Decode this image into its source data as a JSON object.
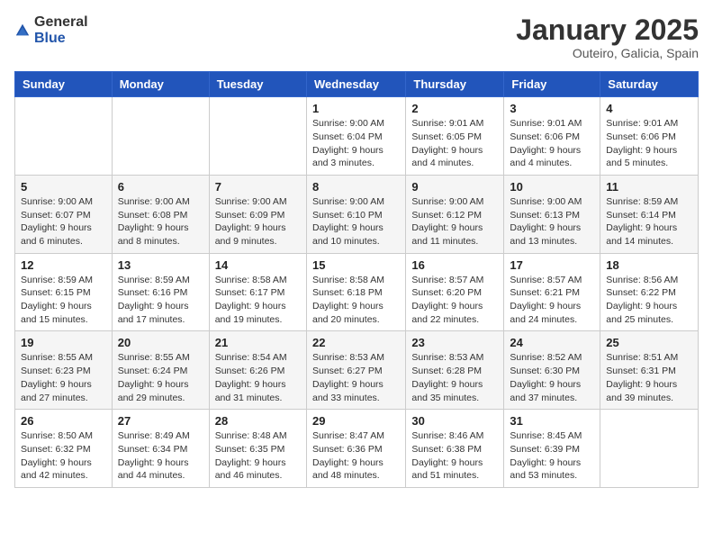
{
  "logo": {
    "general": "General",
    "blue": "Blue"
  },
  "header": {
    "month": "January 2025",
    "location": "Outeiro, Galicia, Spain"
  },
  "weekdays": [
    "Sunday",
    "Monday",
    "Tuesday",
    "Wednesday",
    "Thursday",
    "Friday",
    "Saturday"
  ],
  "weeks": [
    [
      {
        "day": "",
        "sunrise": "",
        "sunset": "",
        "daylight": ""
      },
      {
        "day": "",
        "sunrise": "",
        "sunset": "",
        "daylight": ""
      },
      {
        "day": "",
        "sunrise": "",
        "sunset": "",
        "daylight": ""
      },
      {
        "day": "1",
        "sunrise": "9:00 AM",
        "sunset": "6:04 PM",
        "daylight": "9 hours and 3 minutes."
      },
      {
        "day": "2",
        "sunrise": "9:01 AM",
        "sunset": "6:05 PM",
        "daylight": "9 hours and 4 minutes."
      },
      {
        "day": "3",
        "sunrise": "9:01 AM",
        "sunset": "6:06 PM",
        "daylight": "9 hours and 4 minutes."
      },
      {
        "day": "4",
        "sunrise": "9:01 AM",
        "sunset": "6:06 PM",
        "daylight": "9 hours and 5 minutes."
      }
    ],
    [
      {
        "day": "5",
        "sunrise": "9:00 AM",
        "sunset": "6:07 PM",
        "daylight": "9 hours and 6 minutes."
      },
      {
        "day": "6",
        "sunrise": "9:00 AM",
        "sunset": "6:08 PM",
        "daylight": "9 hours and 8 minutes."
      },
      {
        "day": "7",
        "sunrise": "9:00 AM",
        "sunset": "6:09 PM",
        "daylight": "9 hours and 9 minutes."
      },
      {
        "day": "8",
        "sunrise": "9:00 AM",
        "sunset": "6:10 PM",
        "daylight": "9 hours and 10 minutes."
      },
      {
        "day": "9",
        "sunrise": "9:00 AM",
        "sunset": "6:12 PM",
        "daylight": "9 hours and 11 minutes."
      },
      {
        "day": "10",
        "sunrise": "9:00 AM",
        "sunset": "6:13 PM",
        "daylight": "9 hours and 13 minutes."
      },
      {
        "day": "11",
        "sunrise": "8:59 AM",
        "sunset": "6:14 PM",
        "daylight": "9 hours and 14 minutes."
      }
    ],
    [
      {
        "day": "12",
        "sunrise": "8:59 AM",
        "sunset": "6:15 PM",
        "daylight": "9 hours and 15 minutes."
      },
      {
        "day": "13",
        "sunrise": "8:59 AM",
        "sunset": "6:16 PM",
        "daylight": "9 hours and 17 minutes."
      },
      {
        "day": "14",
        "sunrise": "8:58 AM",
        "sunset": "6:17 PM",
        "daylight": "9 hours and 19 minutes."
      },
      {
        "day": "15",
        "sunrise": "8:58 AM",
        "sunset": "6:18 PM",
        "daylight": "9 hours and 20 minutes."
      },
      {
        "day": "16",
        "sunrise": "8:57 AM",
        "sunset": "6:20 PM",
        "daylight": "9 hours and 22 minutes."
      },
      {
        "day": "17",
        "sunrise": "8:57 AM",
        "sunset": "6:21 PM",
        "daylight": "9 hours and 24 minutes."
      },
      {
        "day": "18",
        "sunrise": "8:56 AM",
        "sunset": "6:22 PM",
        "daylight": "9 hours and 25 minutes."
      }
    ],
    [
      {
        "day": "19",
        "sunrise": "8:55 AM",
        "sunset": "6:23 PM",
        "daylight": "9 hours and 27 minutes."
      },
      {
        "day": "20",
        "sunrise": "8:55 AM",
        "sunset": "6:24 PM",
        "daylight": "9 hours and 29 minutes."
      },
      {
        "day": "21",
        "sunrise": "8:54 AM",
        "sunset": "6:26 PM",
        "daylight": "9 hours and 31 minutes."
      },
      {
        "day": "22",
        "sunrise": "8:53 AM",
        "sunset": "6:27 PM",
        "daylight": "9 hours and 33 minutes."
      },
      {
        "day": "23",
        "sunrise": "8:53 AM",
        "sunset": "6:28 PM",
        "daylight": "9 hours and 35 minutes."
      },
      {
        "day": "24",
        "sunrise": "8:52 AM",
        "sunset": "6:30 PM",
        "daylight": "9 hours and 37 minutes."
      },
      {
        "day": "25",
        "sunrise": "8:51 AM",
        "sunset": "6:31 PM",
        "daylight": "9 hours and 39 minutes."
      }
    ],
    [
      {
        "day": "26",
        "sunrise": "8:50 AM",
        "sunset": "6:32 PM",
        "daylight": "9 hours and 42 minutes."
      },
      {
        "day": "27",
        "sunrise": "8:49 AM",
        "sunset": "6:34 PM",
        "daylight": "9 hours and 44 minutes."
      },
      {
        "day": "28",
        "sunrise": "8:48 AM",
        "sunset": "6:35 PM",
        "daylight": "9 hours and 46 minutes."
      },
      {
        "day": "29",
        "sunrise": "8:47 AM",
        "sunset": "6:36 PM",
        "daylight": "9 hours and 48 minutes."
      },
      {
        "day": "30",
        "sunrise": "8:46 AM",
        "sunset": "6:38 PM",
        "daylight": "9 hours and 51 minutes."
      },
      {
        "day": "31",
        "sunrise": "8:45 AM",
        "sunset": "6:39 PM",
        "daylight": "9 hours and 53 minutes."
      },
      {
        "day": "",
        "sunrise": "",
        "sunset": "",
        "daylight": ""
      }
    ]
  ],
  "labels": {
    "sunrise": "Sunrise:",
    "sunset": "Sunset:",
    "daylight": "Daylight:"
  }
}
